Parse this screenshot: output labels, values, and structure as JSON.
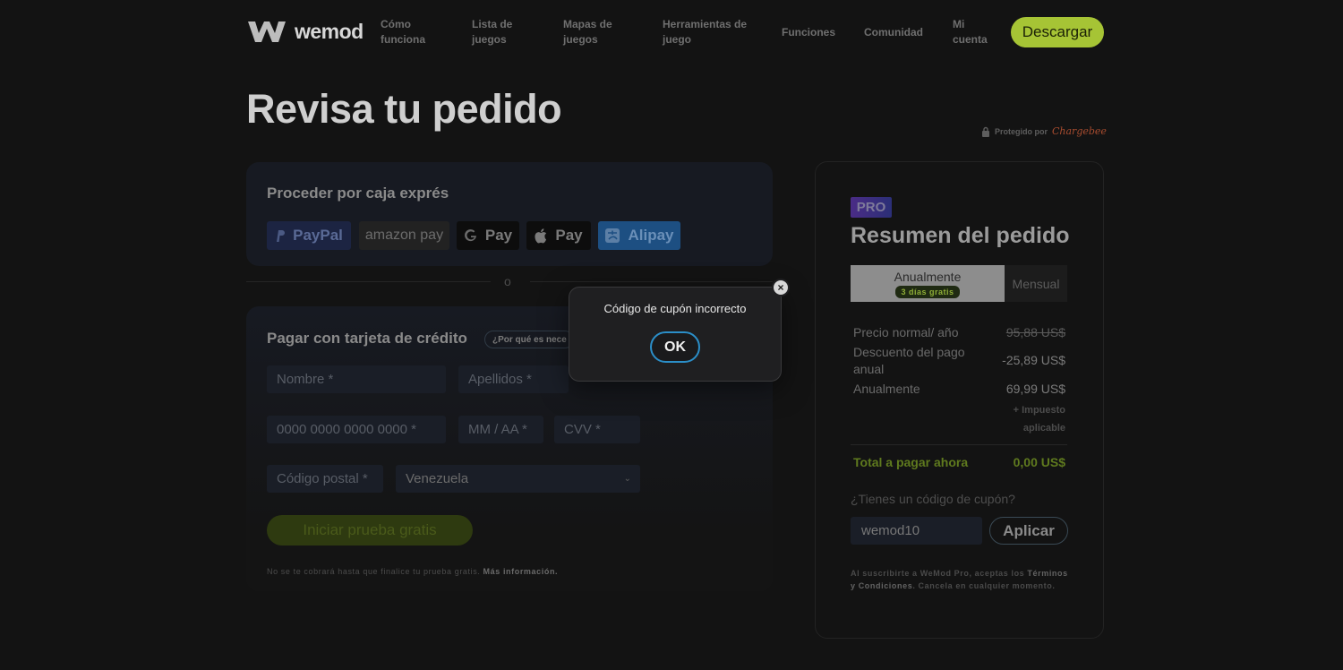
{
  "header": {
    "logo_text": "wemod",
    "nav": [
      {
        "line1": "Cómo",
        "line2": "funciona"
      },
      {
        "line1": "Lista de",
        "line2": "juegos"
      },
      {
        "line1": "Mapas de",
        "line2": "juegos"
      },
      {
        "line1": "Herramientas de",
        "line2": "juego"
      },
      {
        "line1": "Funciones",
        "line2": ""
      },
      {
        "line1": "Comunidad",
        "line2": ""
      },
      {
        "line1": "Mi",
        "line2": "cuenta"
      }
    ],
    "download_label": "Descargar"
  },
  "page": {
    "title": "Revisa tu pedido",
    "secure_text": "Protegido por",
    "secure_brand": "Chargebee"
  },
  "express": {
    "title": "Proceder por caja exprés",
    "paypal": "PayPal",
    "amazon": "amazon pay",
    "gpay": "Pay",
    "applepay": "Pay",
    "alipay": "Alipay",
    "divider": "o"
  },
  "credit": {
    "title": "Pagar con tarjeta de crédito",
    "why_label": "¿Por qué es nece",
    "first_name_placeholder": "Nombre *",
    "last_name_placeholder": "Apellidos *",
    "card_placeholder": "0000 0000 0000 0000 *",
    "expiry_placeholder": "MM / AA *",
    "cvv_placeholder": "CVV *",
    "postal_placeholder": "Código postal *",
    "country_value": "Venezuela",
    "trial_button": "Iniciar prueba gratis",
    "note_text": "No se te cobrará hasta que finalice tu prueba gratis.",
    "note_link": "Más información."
  },
  "summary": {
    "badge": "PRO",
    "title": "Resumen del pedido",
    "annual_label": "Anualmente",
    "trial_tag": "3 días gratis",
    "monthly_label": "Mensual",
    "rows": [
      {
        "label": "Precio normal/ año",
        "value": "95,88 US$"
      },
      {
        "label": "Descuento del pago anual",
        "value": "-25,89 US$"
      },
      {
        "label": "Anualmente",
        "value": "69,99 US$"
      }
    ],
    "tax_note": "+ Impuesto aplicable",
    "total_label": "Total a pagar ahora",
    "total_value": "0,00 US$",
    "coupon_question": "¿Tienes un código de cupón?",
    "coupon_value": "wemod10",
    "apply_label": "Aplicar",
    "terms_pre": "Al suscribirte a WeMod Pro, aceptas los",
    "terms_link": "Términos y Condiciones",
    "terms_post": ". Cancela en cualquier momento."
  },
  "modal": {
    "message": "Código de cupón incorrecto",
    "ok_label": "OK",
    "close_glyph": "×"
  }
}
